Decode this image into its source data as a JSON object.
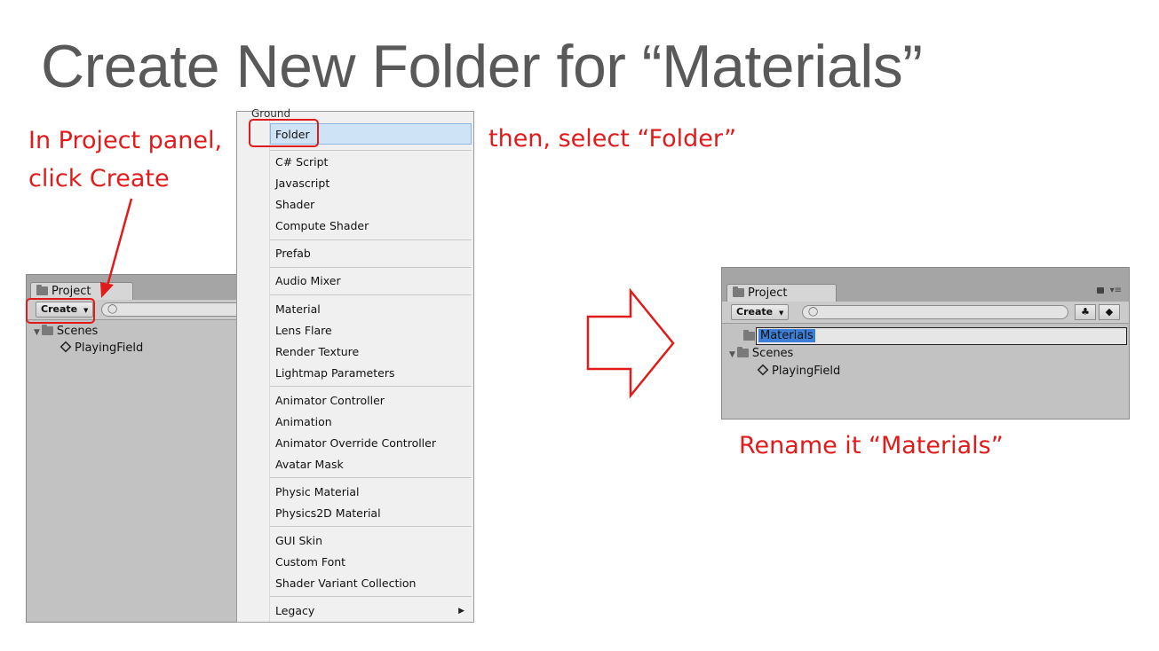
{
  "slide": {
    "title": "Create New Folder for “Materials”",
    "annotation_left_line1": "In Project panel,",
    "annotation_left_line2": "click Create",
    "annotation_top": "then, select “Folder”",
    "annotation_bottom": "Rename it “Materials”"
  },
  "left_panel": {
    "tab_label": "Project",
    "create_label": "Create",
    "tree": [
      {
        "label": "Scenes",
        "type": "folder"
      },
      {
        "label": "PlayingField",
        "type": "scene"
      }
    ]
  },
  "context_menu": {
    "header": "Ground",
    "groups": [
      [
        "Folder"
      ],
      [
        "C# Script",
        "Javascript",
        "Shader",
        "Compute Shader"
      ],
      [
        "Prefab"
      ],
      [
        "Audio Mixer"
      ],
      [
        "Material",
        "Lens Flare",
        "Render Texture",
        "Lightmap Parameters"
      ],
      [
        "Animator Controller",
        "Animation",
        "Animator Override Controller",
        "Avatar Mask"
      ],
      [
        "Physic Material",
        "Physics2D Material"
      ],
      [
        "GUI Skin",
        "Custom Font",
        "Shader Variant Collection"
      ],
      [
        "Legacy"
      ]
    ],
    "highlighted": "Folder",
    "submenu_item": "Legacy"
  },
  "right_panel": {
    "tab_label": "Project",
    "create_label": "Create",
    "renaming_value": "Materials",
    "tree": [
      {
        "label": "Scenes",
        "type": "folder"
      },
      {
        "label": "PlayingField",
        "type": "scene"
      }
    ]
  },
  "colors": {
    "annotation": "#e11b1b",
    "title": "#595959",
    "selection": "#3d7fd6"
  },
  "icons": [
    "folder-icon",
    "unity-scene-icon",
    "search-icon",
    "lock-icon",
    "menu-icon",
    "filter-icon",
    "label-icon",
    "arrow-right-icon"
  ]
}
